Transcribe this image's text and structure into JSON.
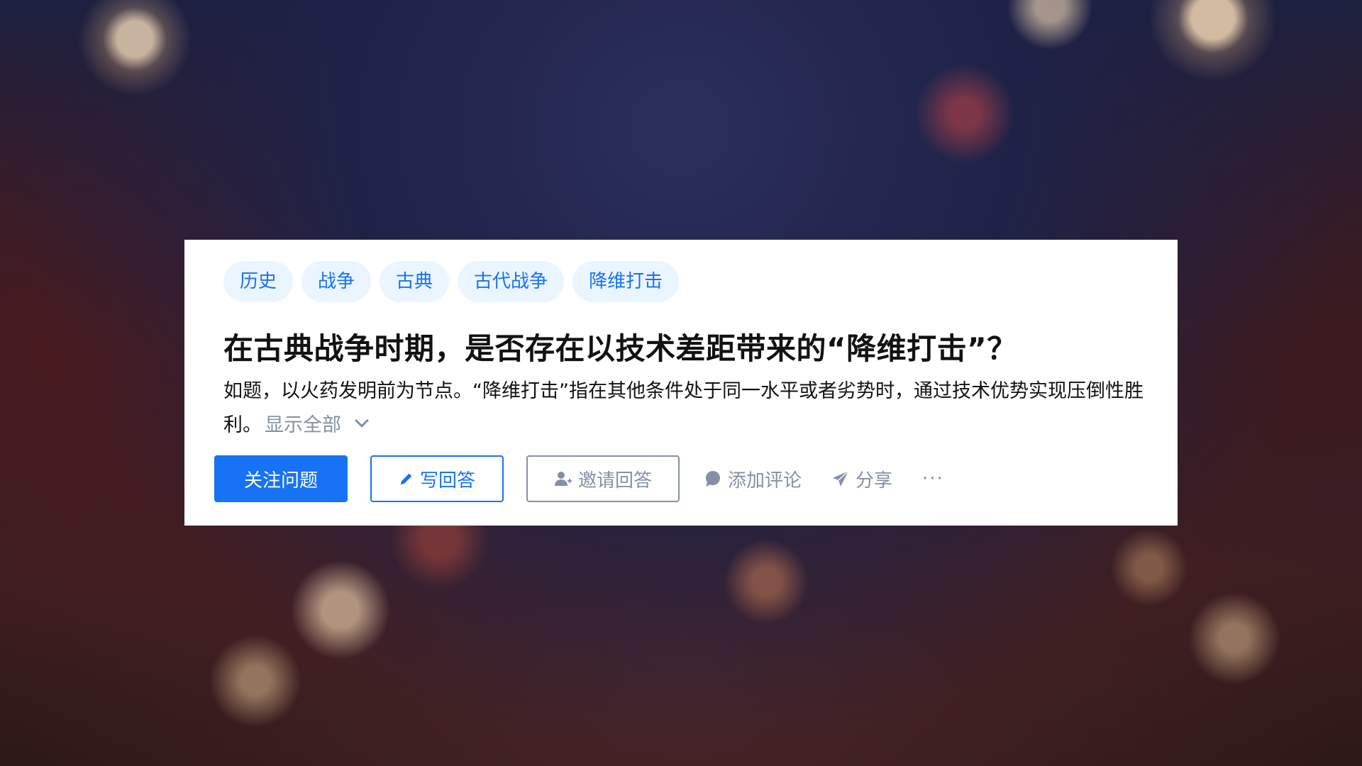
{
  "topics": [
    "历史",
    "战争",
    "古典",
    "古代战争",
    "降维打击"
  ],
  "question": {
    "title": "在古典战争时期，是否存在以技术差距带来的“降维打击”？",
    "description": "如题，以火药发明前为节点。“降维打击”指在其他条件处于同一水平或者劣势时，通过技术优势实现压倒性胜利。",
    "show_all_label": "显示全部"
  },
  "actions": {
    "follow_label": "关注问题",
    "write_answer_label": "写回答",
    "invite_label": "邀请回答",
    "comment_label": "添加评论",
    "share_label": "分享",
    "more_label": "···"
  },
  "colors": {
    "brand_blue": "#1772f6",
    "muted_gray": "#8590a6",
    "tag_bg": "#ebf5ff"
  }
}
